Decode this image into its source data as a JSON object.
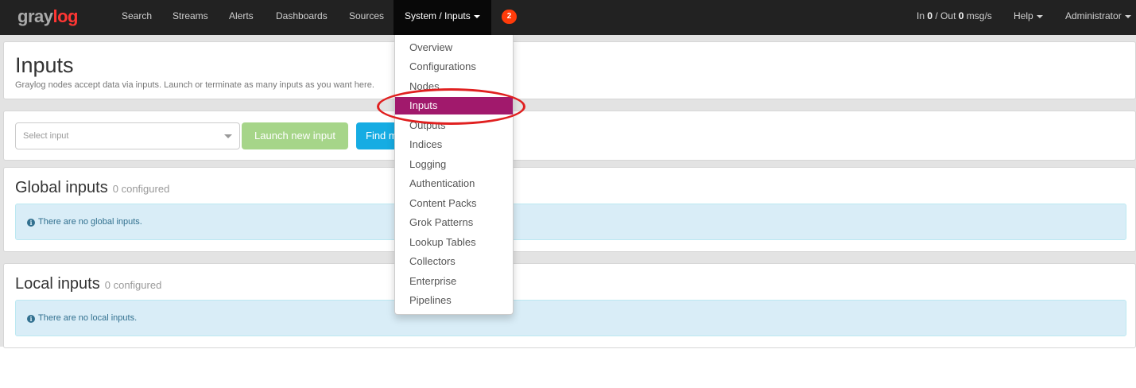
{
  "brand": {
    "part1": "gray",
    "part2": "log"
  },
  "nav": {
    "search": "Search",
    "streams": "Streams",
    "alerts": "Alerts",
    "dashboards": "Dashboards",
    "sources": "Sources",
    "system": "System / Inputs",
    "notification_count": "2",
    "throughput": {
      "in_label": "In",
      "in_value": "0",
      "sep": "/ Out",
      "out_value": "0",
      "unit": "msg/s"
    },
    "help": "Help",
    "user": "Administrator"
  },
  "header": {
    "title": "Inputs",
    "description": "Graylog nodes accept data via inputs. Launch or terminate as many inputs as you want here."
  },
  "launch": {
    "select_placeholder": "Select input",
    "launch_button": "Launch new input",
    "find_button": "Find more inputs"
  },
  "global_inputs": {
    "title": "Global inputs",
    "count": "0 configured",
    "empty_message": "There are no global inputs."
  },
  "local_inputs": {
    "title": "Local inputs",
    "count": "0 configured",
    "empty_message": "There are no local inputs."
  },
  "system_menu": {
    "items": [
      "Overview",
      "Configurations",
      "Nodes",
      "Inputs",
      "Outputs",
      "Indices",
      "Logging",
      "Authentication",
      "Content Packs",
      "Grok Patterns",
      "Lookup Tables",
      "Collectors",
      "Enterprise",
      "Pipelines"
    ],
    "active": "Inputs"
  },
  "colors": {
    "navbar": "#222222",
    "brand_accent": "#ff3633",
    "menu_active": "#a1196c",
    "launch_button": "#a6d589",
    "find_button": "#16ace3",
    "info_alert": "#d9edf7",
    "badge": "#ff3b0a",
    "annotation": "#e02020"
  }
}
